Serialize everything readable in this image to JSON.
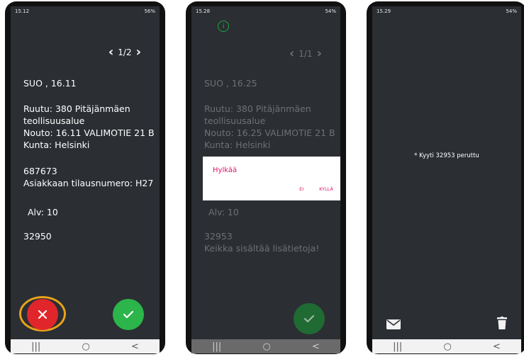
{
  "phone1": {
    "status_time": "15.12",
    "status_right": "56%",
    "pager": "1/2",
    "lines": [
      "SUO , 16.11",
      "Ruutu: 380 Pitäjänmäen",
      "teollisuusalue",
      "Nouto: 16.11 VALIMOTIE 21 B",
      "Kunta: Helsinki",
      "687673",
      "Asiakkaan tilausnumero: H27",
      "Alv: 10",
      "32950"
    ]
  },
  "phone2": {
    "status_time": "15.28",
    "status_right": "54%",
    "info_icon": "i",
    "pager": "1/1",
    "lines": [
      "SUO , 16.25",
      "Ruutu: 380 Pitäjänmäen",
      "teollisuusalue",
      "Nouto: 16.25 VALIMOTIE 21 B",
      "Kunta: Helsinki",
      "Alv: 10",
      "32953",
      "Keikka sisältää lisätietoja!"
    ],
    "dialog": {
      "title": "Hylkää",
      "no": "EI",
      "yes": "KYLLÄ"
    }
  },
  "phone3": {
    "status_time": "15.29",
    "status_right": "54%",
    "message": "* Kyyti 32953 peruttu"
  },
  "nav": {
    "recent": "|||",
    "home": "○",
    "back": "<"
  },
  "colors": {
    "reject": "#e0262b",
    "accept": "#2bb54a",
    "highlight": "#e8a21a",
    "dialog_accent": "#e0136b"
  }
}
